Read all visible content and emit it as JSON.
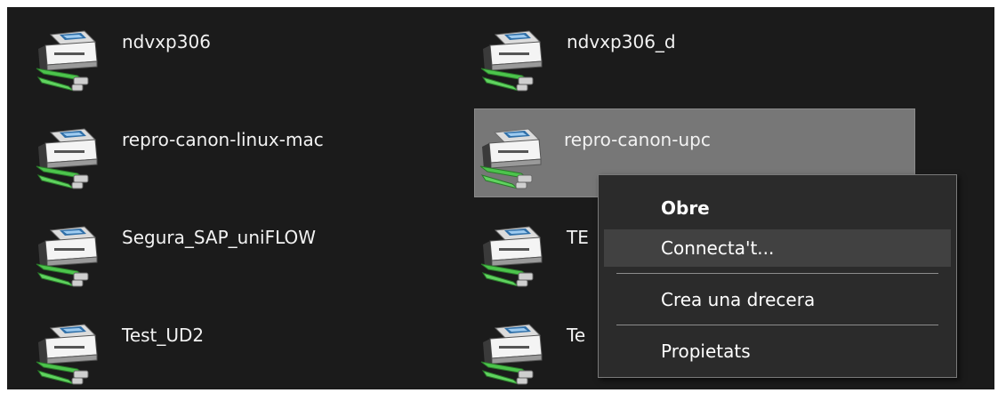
{
  "printers": [
    {
      "label": "ndvxp306",
      "selected": false,
      "icon": "network-printer-icon"
    },
    {
      "label": "ndvxp306_d",
      "selected": false,
      "icon": "network-printer-icon"
    },
    {
      "label": "repro-canon-linux-mac",
      "selected": false,
      "icon": "network-printer-icon"
    },
    {
      "label": "repro-canon-upc",
      "selected": true,
      "icon": "network-printer-icon"
    },
    {
      "label": "Segura_SAP_uniFLOW",
      "selected": false,
      "icon": "network-printer-icon"
    },
    {
      "label": "TE",
      "selected": false,
      "icon": "network-printer-icon"
    },
    {
      "label": "Test_UD2",
      "selected": false,
      "icon": "network-printer-icon"
    },
    {
      "label": "Te",
      "selected": false,
      "icon": "network-printer-icon"
    }
  ],
  "context_menu": {
    "items": [
      {
        "label": "Obre",
        "default": true
      },
      {
        "label": "Connecta't...",
        "hovered": true
      },
      {
        "label": "Crea una drecera"
      },
      {
        "label": "Propietats"
      }
    ]
  },
  "colors": {
    "background": "#1b1b1b",
    "selection": "#777777",
    "menu_background": "#2b2b2b",
    "menu_hover": "#414141",
    "cable_green": "#4cc44c"
  }
}
